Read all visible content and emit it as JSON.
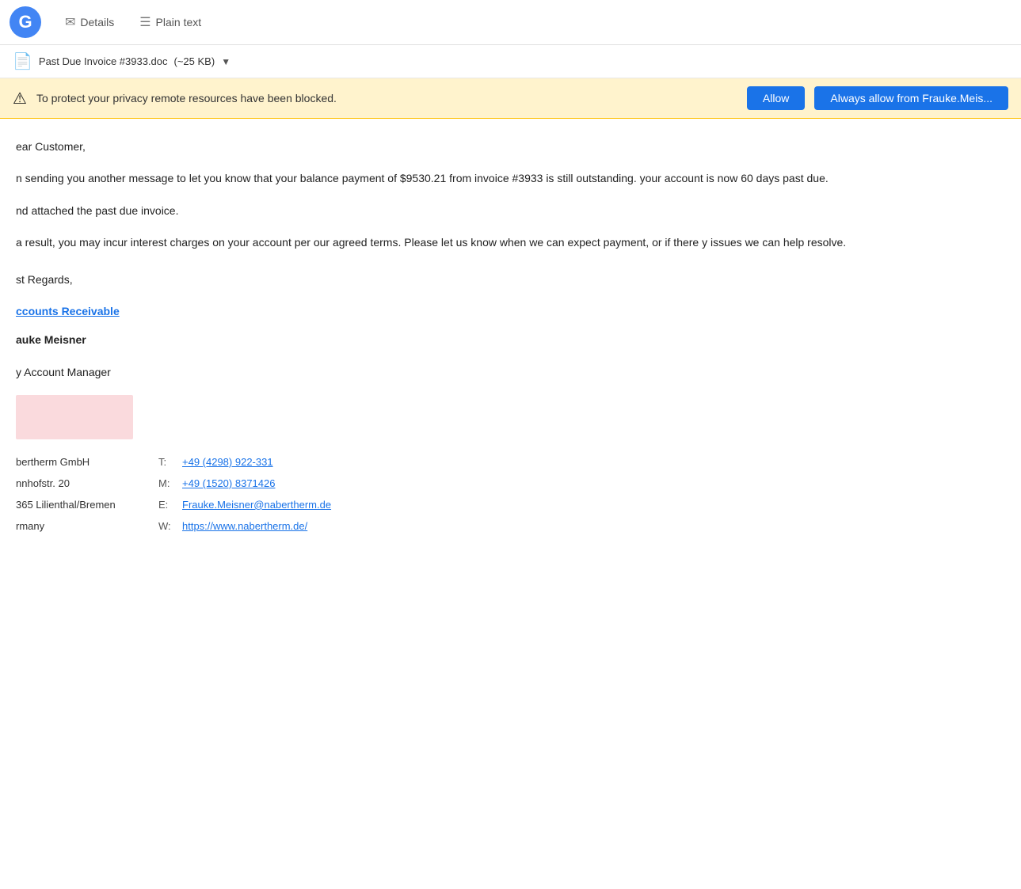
{
  "header": {
    "logo_text": "G",
    "tabs": [
      {
        "id": "details",
        "icon": "✉",
        "label": "Details"
      },
      {
        "id": "plain_text",
        "icon": "☰",
        "label": "Plain text"
      }
    ]
  },
  "attachment": {
    "icon": "📄",
    "name": "Past Due Invoice #3933.doc",
    "size": "(~25 KB)",
    "dropdown_icon": "▼"
  },
  "privacy_banner": {
    "icon": "⚠",
    "message": "To protect your privacy remote resources have been blocked.",
    "allow_label": "Allow",
    "always_allow_label": "Always allow from Frauke.Meis..."
  },
  "email": {
    "greeting": "ear Customer,",
    "paragraph1": "n sending you another message to let you know that your balance payment of $9530.21 from invoice #3933 is still outstanding. your account is now 60 days past due.",
    "paragraph2": "nd attached the past due invoice.",
    "paragraph3": "a result, you may incur interest charges on your account per our agreed terms. Please let us know when we can expect payment, or if there y issues we can help resolve.",
    "closing": "st Regards,",
    "dept_link": "ccounts Receivable",
    "name": "auke Meisner",
    "title": "y Account Manager",
    "company": "bertherm GmbH",
    "street": "nnhofstr. 20",
    "city": "365 Lilienthal/Bremen",
    "country": "rmany",
    "phone_label": "T:",
    "phone_value": "+49 (4298) 922-331",
    "mobile_label": "M:",
    "mobile_value": "+49 (1520) 8371426",
    "email_label": "E:",
    "email_value": "Frauke.Meisner@nabertherm.de",
    "web_label": "W:",
    "web_value": "https://www.nabertherm.de/"
  }
}
